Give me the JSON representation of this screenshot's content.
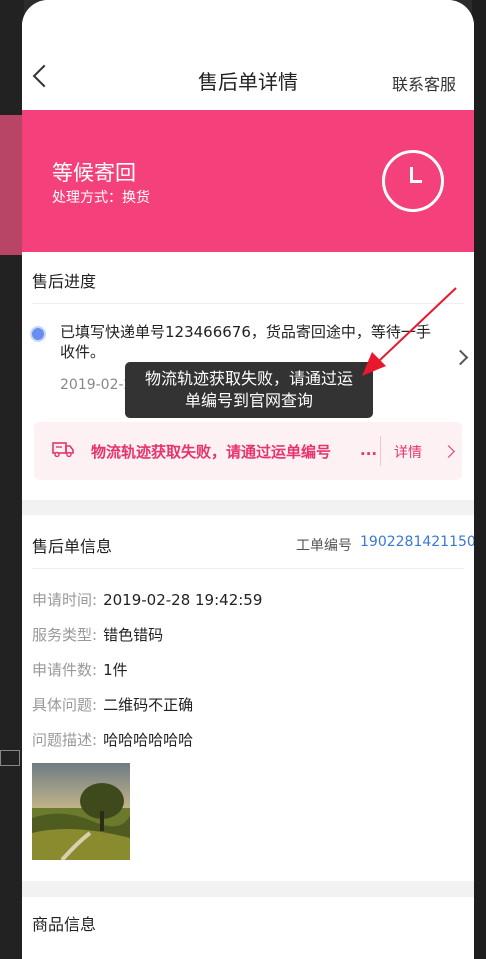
{
  "nav": {
    "title": "售后单详情",
    "service": "联系客服"
  },
  "status": {
    "title": "等候寄回",
    "subtitle": "处理方式：换货"
  },
  "progress": {
    "section_title": "售后进度",
    "text": "已填写快递单号123466676，货品寄回途中，等待一手收件。",
    "time": "2019-02-2",
    "fail_text": "物流轨迹获取失败，请通过运单编号",
    "fail_ellipsis": "...",
    "detail_label": "详情"
  },
  "tooltip": {
    "line1": "物流轨迹获取失败，请通过运",
    "line2": "单编号到官网查询"
  },
  "info": {
    "section_title": "售后单信息",
    "order_label": "工单编号",
    "order_value": "1902281421150",
    "rows": [
      {
        "key": "申请时间:",
        "value": "2019-02-28 19:42:59"
      },
      {
        "key": "服务类型:",
        "value": "错色错码"
      },
      {
        "key": "申请件数:",
        "value": "1件"
      },
      {
        "key": "具体问题:",
        "value": "二维码不正确"
      },
      {
        "key": "问题描述:",
        "value": "哈哈哈哈哈哈"
      }
    ]
  },
  "goods": {
    "section_title": "商品信息"
  },
  "colors": {
    "accent": "#f5417b",
    "link": "#3a78d6",
    "arrow": "#e8192c"
  }
}
